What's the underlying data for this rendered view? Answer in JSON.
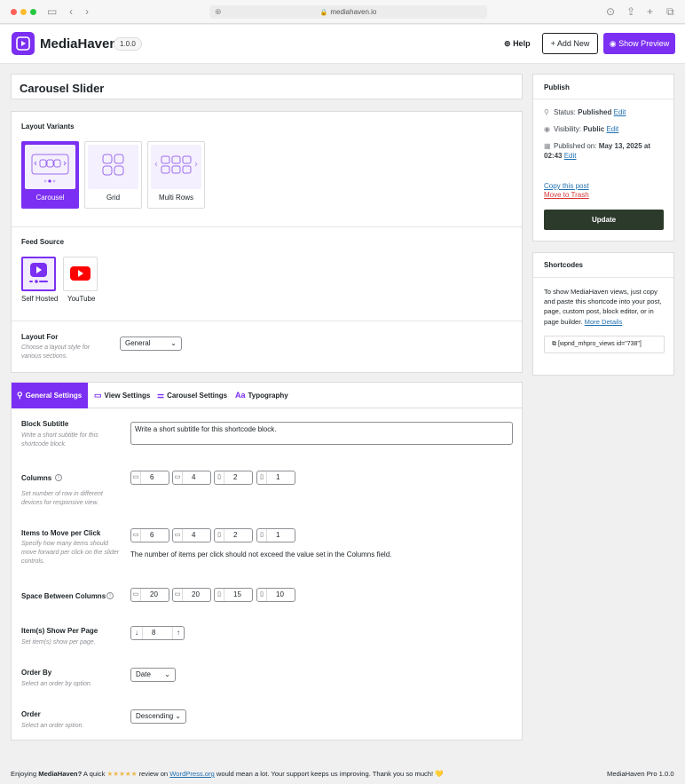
{
  "browser": {
    "url": "mediahaven.io"
  },
  "header": {
    "brand": "MediaHaven",
    "version": "1.0.0",
    "help_label": "Help",
    "add_new_label": "+ Add New",
    "show_preview_label": "Show Preview",
    "accent_color": "#7b2ff2"
  },
  "page": {
    "title": "Carousel Slider"
  },
  "layout": {
    "variants_label": "Layout Variants",
    "variants": [
      {
        "label": "Carousel",
        "selected": true
      },
      {
        "label": "Grid",
        "selected": false
      },
      {
        "label": "Multi Rows",
        "selected": false
      }
    ],
    "feed_source_label": "Feed Source",
    "sources": [
      {
        "label": "Self Hosted",
        "selected": true
      },
      {
        "label": "YouTube",
        "selected": false
      }
    ],
    "layout_for": {
      "label": "Layout For",
      "description": "Choose a layout style for various sections.",
      "value": "General"
    }
  },
  "tabs": [
    {
      "label": "General Settings",
      "icon": "wrench-icon",
      "active": true
    },
    {
      "label": "View Settings",
      "icon": "monitor-icon",
      "active": false
    },
    {
      "label": "Carousel Settings",
      "icon": "sliders-icon",
      "active": false
    },
    {
      "label": "Typography",
      "icon": "font-icon",
      "active": false
    }
  ],
  "settings": {
    "block_subtitle": {
      "label": "Block Subtitle",
      "description": "Write a short subtitle for this shortcode block.",
      "value": "Write a short subtitle for this shortcode block."
    },
    "columns": {
      "label": "Columns",
      "description": "Set number of row in different devices for responsive view.",
      "values": [
        "6",
        "4",
        "2",
        "1"
      ]
    },
    "items_per_click": {
      "label": "Items to Move per Click",
      "description": "Specify how many items should move forward per click on the slider controls.",
      "values": [
        "6",
        "4",
        "2",
        "1"
      ],
      "note": "The number of items per click should not exceed the value set in the Columns field."
    },
    "space_between": {
      "label": "Space Between Columns",
      "values": [
        "20",
        "20",
        "15",
        "10"
      ]
    },
    "items_per_page": {
      "label": "Item(s) Show Per Page",
      "description": "Set item(s) show per page.",
      "value": "8"
    },
    "order_by": {
      "label": "Order By",
      "description": "Select an order by option.",
      "value": "Date"
    },
    "order": {
      "label": "Order",
      "description": "Select an order option.",
      "value": "Descending"
    }
  },
  "publish": {
    "title": "Publish",
    "status_label": "Status:",
    "status_value": "Published",
    "visibility_label": "Visibility:",
    "visibility_value": "Public",
    "published_label": "Published on:",
    "published_value": "May 13, 2025 at 02:43",
    "edit_label": "Edit",
    "copy_label": "Copy this post",
    "trash_label": "Move to Trash",
    "update_label": "Update"
  },
  "shortcodes": {
    "title": "Shortcodes",
    "text": "To show MediaHaven views, just copy and paste this shortcode into your post, page, custom post, block editor, or in page builder.",
    "more_label": "More Details",
    "code": "[wpnd_mhpro_views id=\"738\"]"
  },
  "footer": {
    "left_prefix": "Enjoying ",
    "left_brand": "MediaHaven?",
    "left_middle": " A quick ",
    "stars": "★★★★★",
    "left_review": " review on ",
    "left_link": "WordPress.org",
    "left_suffix": " would mean a lot. Your support keeps us improving. Thank you so much! 💛",
    "right": "MediaHaven Pro 1.0.0"
  }
}
